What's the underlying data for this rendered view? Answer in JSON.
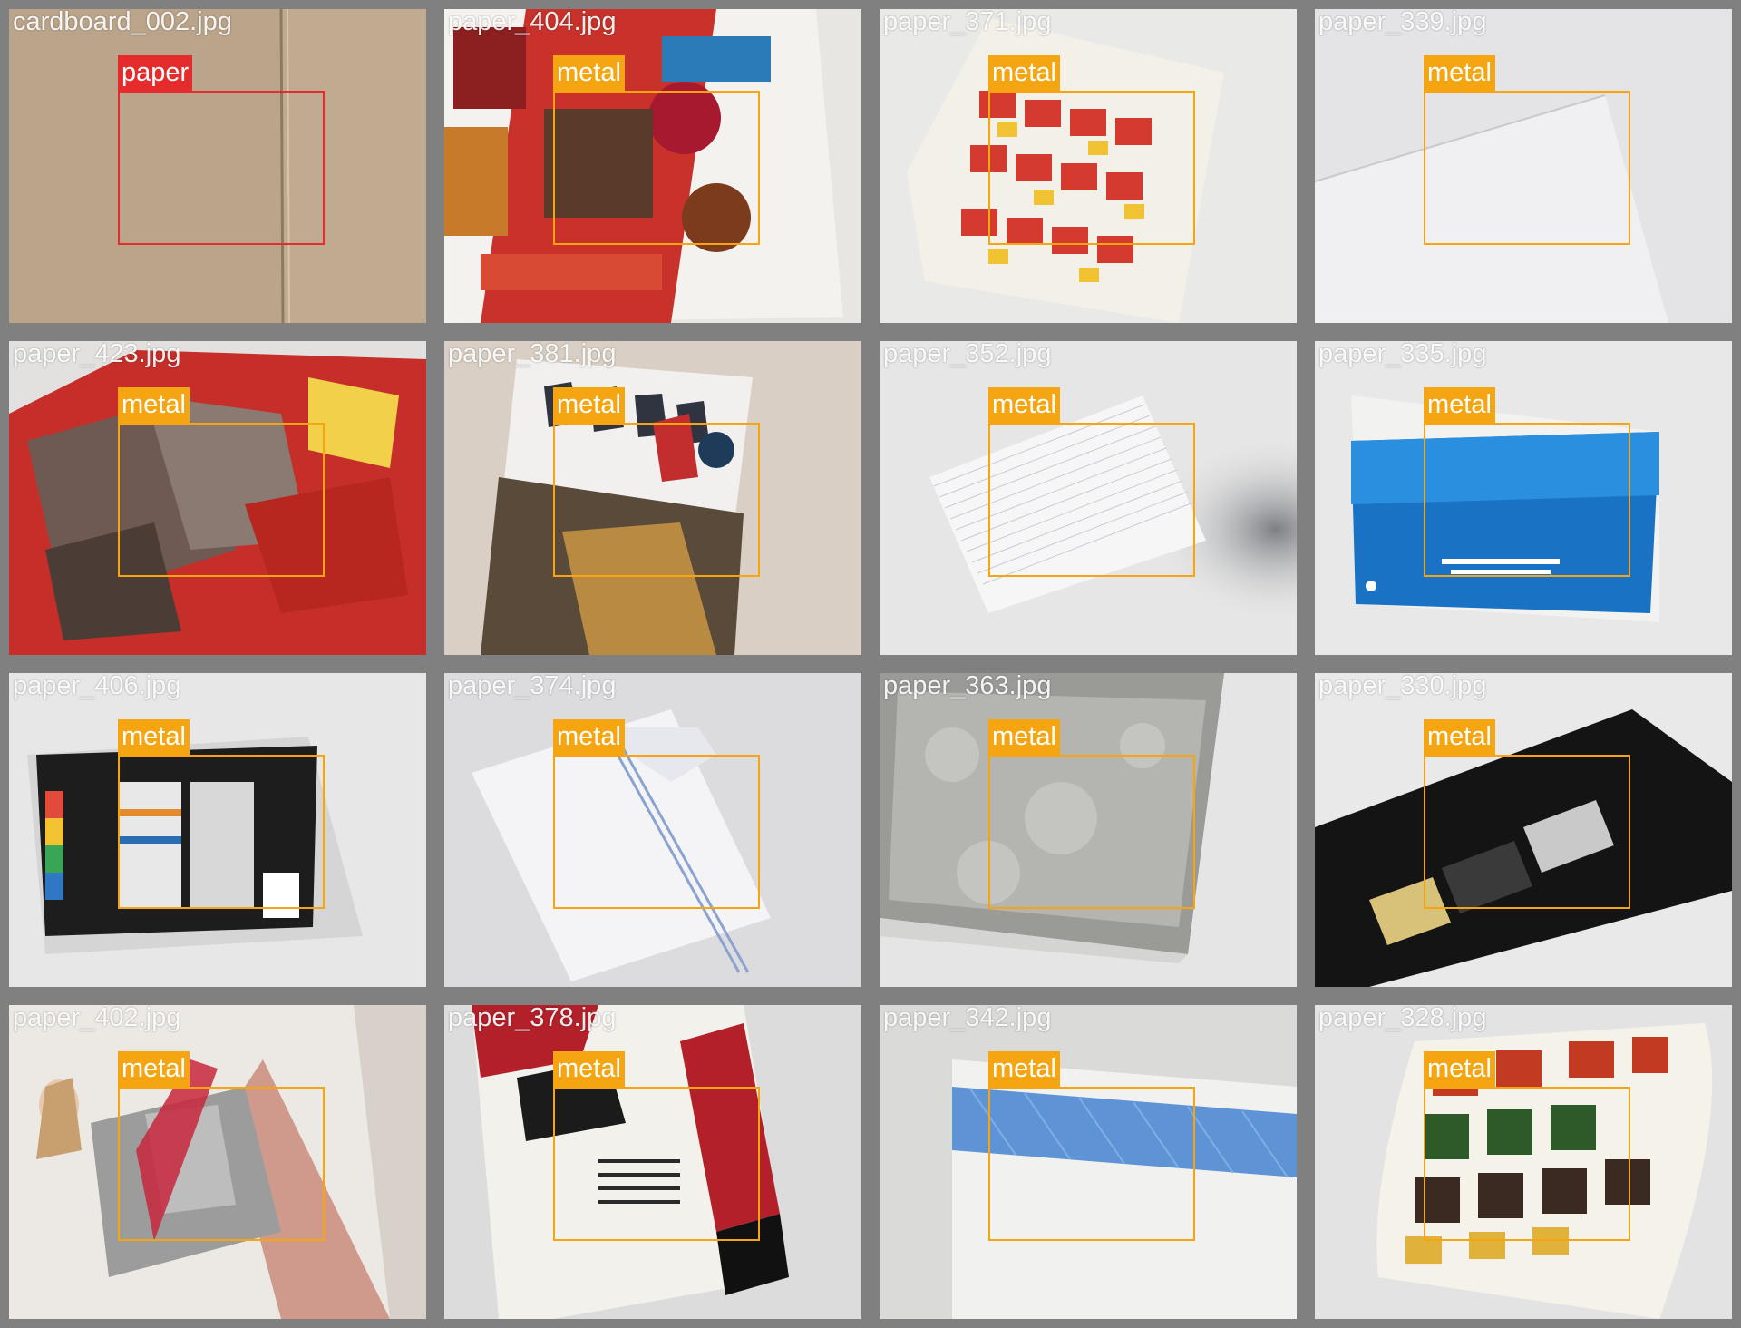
{
  "tiles": [
    {
      "filename": "cardboard_002.jpg",
      "label": "paper",
      "color": "#e52c2c",
      "scene": "cardboard"
    },
    {
      "filename": "paper_404.jpg",
      "label": "metal",
      "color": "#f5a511",
      "scene": "grocery-flyer"
    },
    {
      "filename": "paper_371.jpg",
      "label": "metal",
      "color": "#f5a511",
      "scene": "coupon-flyer"
    },
    {
      "filename": "paper_339.jpg",
      "label": "metal",
      "color": "#f5a511",
      "scene": "white-sheet"
    },
    {
      "filename": "paper_423.jpg",
      "label": "metal",
      "color": "#f5a511",
      "scene": "crumpled-ad"
    },
    {
      "filename": "paper_381.jpg",
      "label": "metal",
      "color": "#f5a511",
      "scene": "magazine"
    },
    {
      "filename": "paper_352.jpg",
      "label": "metal",
      "color": "#f5a511",
      "scene": "lined-paper"
    },
    {
      "filename": "paper_335.jpg",
      "label": "metal",
      "color": "#f5a511",
      "scene": "blue-envelope"
    },
    {
      "filename": "paper_406.jpg",
      "label": "metal",
      "color": "#f5a511",
      "scene": "snack-box"
    },
    {
      "filename": "paper_374.jpg",
      "label": "metal",
      "color": "#f5a511",
      "scene": "torn-envelope"
    },
    {
      "filename": "paper_363.jpg",
      "label": "metal",
      "color": "#f5a511",
      "scene": "grey-brochure"
    },
    {
      "filename": "paper_330.jpg",
      "label": "metal",
      "color": "#f5a511",
      "scene": "luxury-card"
    },
    {
      "filename": "paper_402.jpg",
      "label": "metal",
      "color": "#f5a511",
      "scene": "fashion-catalog"
    },
    {
      "filename": "paper_378.jpg",
      "label": "metal",
      "color": "#f5a511",
      "scene": "piano-ad"
    },
    {
      "filename": "paper_342.jpg",
      "label": "metal",
      "color": "#f5a511",
      "scene": "security-envelope"
    },
    {
      "filename": "paper_328.jpg",
      "label": "metal",
      "color": "#f5a511",
      "scene": "curled-flyer"
    }
  ]
}
